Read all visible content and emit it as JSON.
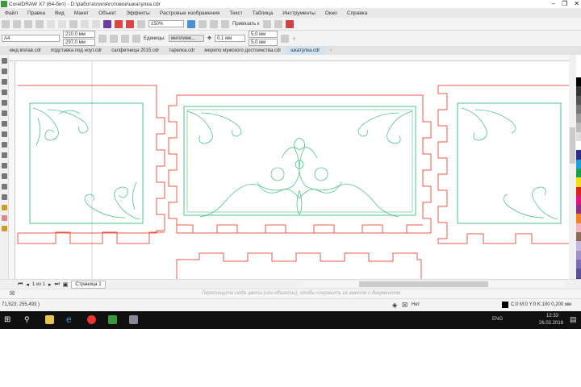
{
  "window": {
    "title": "CorelDRAW X7 (64-бит) - D:\\работа\\лиля\\готовое\\шкатулка.cdr"
  },
  "menu": [
    "Файл",
    "Правка",
    "Вид",
    "Макет",
    "Объект",
    "Эффекты",
    "Растровые изображения",
    "Текст",
    "Таблица",
    "Инструменты",
    "Окно",
    "Справка"
  ],
  "toolbar": {
    "zoom": "150%",
    "snap_label": "Привязать к"
  },
  "propbar": {
    "preset": "А4",
    "width": "210,0 мм",
    "height": "297,0 мм",
    "units_label": "Единицы:",
    "units_value": "миллиме...",
    "nudge": "0,1 мм",
    "dup_x": "5,0 мм",
    "dup_y": "5,0 мм"
  },
  "tabs": [
    "мед вплав.cdr",
    "подставка под ноут.cdr",
    "салфетница 2015.cdr",
    "тарелка.cdr",
    "мерило мужского достоинства.cdr",
    "шкатулка.cdr"
  ],
  "pagenav": {
    "counter": "1 из 1",
    "page_tab": "Страница 1"
  },
  "dropbar": {
    "hint": "Перетащите сюда цвета (или объекты), чтобы сохранить их вместе с документом"
  },
  "status": {
    "coords": "71,523; 255,493 )",
    "fill_label": "Нет",
    "outline_info": "C:0 M:0 Y:0 K:100  0,200 мм"
  },
  "taskbar": {
    "lang": "ENG",
    "time": "12:33",
    "date": "26.02.2018"
  },
  "colors": {
    "outline": "#e8584a",
    "ornament": "#4cc487",
    "palette": [
      "#000000",
      "#333333",
      "#555555",
      "#777777",
      "#999999",
      "#bbbbbb",
      "#dddddd",
      "#ffffff",
      "#2b2d8f",
      "#1aa0e0",
      "#12a34a",
      "#f5e10a",
      "#e3201b",
      "#e4117f",
      "#8e2c8a",
      "#f58220",
      "#f7b3c2",
      "#8b6a57",
      "#c6b7e0",
      "#9f8fcf",
      "#7d6bb8",
      "#5d4fa0",
      "#3c3a80"
    ]
  }
}
